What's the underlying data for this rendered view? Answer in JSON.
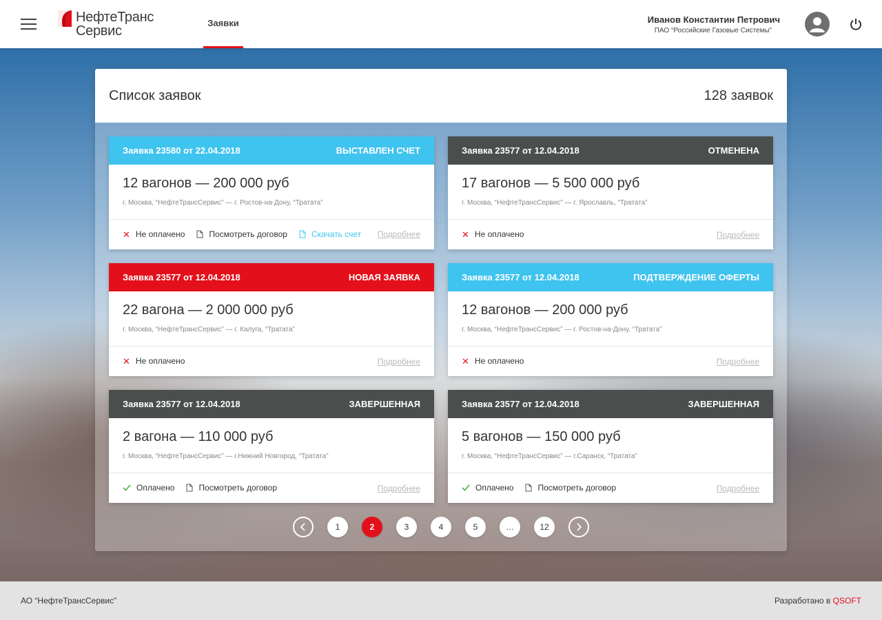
{
  "header": {
    "logo_line1": "НефтеТранс",
    "logo_line2": "Сервис",
    "nav_tab": "Заявки",
    "user_name": "Иванов Константин Петрович",
    "user_org": "ПАО “Российские Газовые Системы”"
  },
  "panel": {
    "title": "Список заявок",
    "count": "128 заявок"
  },
  "cards": [
    {
      "header": "Заявка 23580 от 22.04.2018",
      "status": "ВЫСТАВЛЕН СЧЕТ",
      "status_color": "#3fc3ef",
      "title": "12 вагонов — 200 000 руб",
      "route": "г. Москва, “НефтеТрансСервис” — г. Ростов-на-Дону, “Тратата”",
      "payment": "Не оплачено",
      "view_contract": "Посмотреть договор",
      "download_invoice": "Скачать счет",
      "details": "Подробнее"
    },
    {
      "header": "Заявка 23577 от 12.04.2018",
      "status": "ОТМЕНЕНА",
      "status_color": "#4a4e4d",
      "title": "17 вагонов — 5 500 000 руб",
      "route": "г. Москва, “НефтеТрансСервис” — г. Ярославль, “Тратата”",
      "payment": "Не оплачено",
      "details": "Подробнее"
    },
    {
      "header": "Заявка 23577 от 12.04.2018",
      "status": "НОВАЯ ЗАЯВКА",
      "status_color": "#e3101b",
      "title": "22 вагона — 2 000 000 руб",
      "route": "г. Москва, “НефтеТрансСервис” — г. Калуга, “Тратата”",
      "payment": "Не оплачено",
      "details": "Подробнее"
    },
    {
      "header": "Заявка 23577 от 12.04.2018",
      "status": "ПОДТВЕРЖДЕНИЕ ОФЕРТЫ",
      "status_color": "#3fc3ef",
      "title": "12 вагонов — 200 000 руб",
      "route": "г. Москва, “НефтеТрансСервис” — г. Ростов-на-Дону, “Тратата”",
      "payment": "Не оплачено",
      "details": "Подробнее"
    },
    {
      "header": "Заявка 23577 от 12.04.2018",
      "status": "ЗАВЕРШЕННАЯ",
      "status_color": "#4a4e4d",
      "title": "2 вагона — 110 000 руб",
      "route": "г. Москва, “НефтеТрансСервис” — г.Нижний Новгород, “Тратата”",
      "payment": "Оплачено",
      "view_contract": "Посмотреть договор",
      "details": "Подробнее"
    },
    {
      "header": "Заявка 23577 от 12.04.2018",
      "status": "ЗАВЕРШЕННАЯ",
      "status_color": "#4a4e4d",
      "title": "5 вагонов — 150 000 руб",
      "route": "г. Москва, “НефтеТрансСервис” — г.Саранск, “Тратата”",
      "payment": "Оплачено",
      "view_contract": "Посмотреть договор",
      "details": "Подробнее"
    }
  ],
  "pagination": {
    "pages": [
      "1",
      "2",
      "3",
      "4",
      "5",
      "…",
      "12"
    ],
    "current": "2"
  },
  "footer": {
    "left": "АО “НефтеТрансСервис”",
    "right_prefix": "Разработано в",
    "right_brand": "QSOFT"
  },
  "colors": {
    "accent": "#e3101b",
    "info": "#3fc3ef",
    "dark": "#4a4e4d",
    "success": "#5cb85c"
  }
}
